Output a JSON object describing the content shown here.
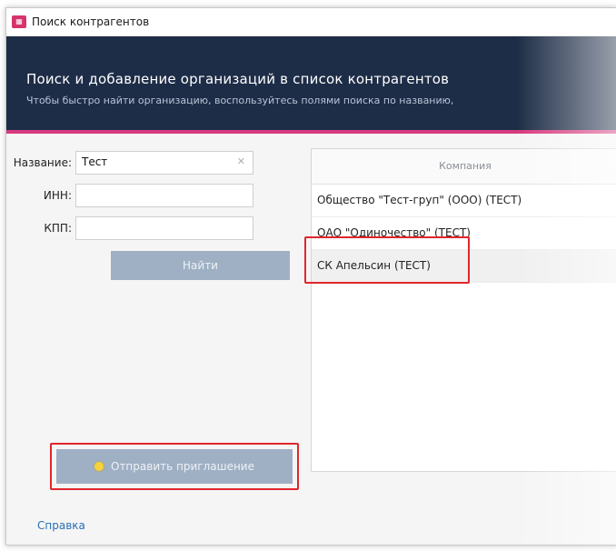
{
  "window": {
    "title": "Поиск контрагентов",
    "icon": "contractors-app-icon"
  },
  "banner": {
    "title": "Поиск и добавление организаций в список контрагентов",
    "subtitle": "Чтобы быстро найти организацию, воспользуйтесь полями поиска по названию,"
  },
  "search": {
    "name_label": "Название:",
    "name_value": "Тест",
    "inn_label": "ИНН:",
    "inn_value": "",
    "kpp_label": "КПП:",
    "kpp_value": "",
    "find_label": "Найти"
  },
  "results": {
    "column_header": "Компания",
    "rows": [
      "Общество \"Тест-груп\" (ООО) (ТЕСТ)",
      "ОАО \"Одиночество\" (ТЕСТ)",
      "СК Апельсин (ТЕСТ)"
    ]
  },
  "actions": {
    "invite_label": "Отправить приглашение"
  },
  "footer": {
    "help_label": "Справка"
  },
  "colors": {
    "banner_bg": "#1e2d47",
    "accent_stripe": "#d63a7e",
    "button_bg": "#9fb0c4",
    "highlight": "#e0262b",
    "link": "#2a6fb5"
  }
}
